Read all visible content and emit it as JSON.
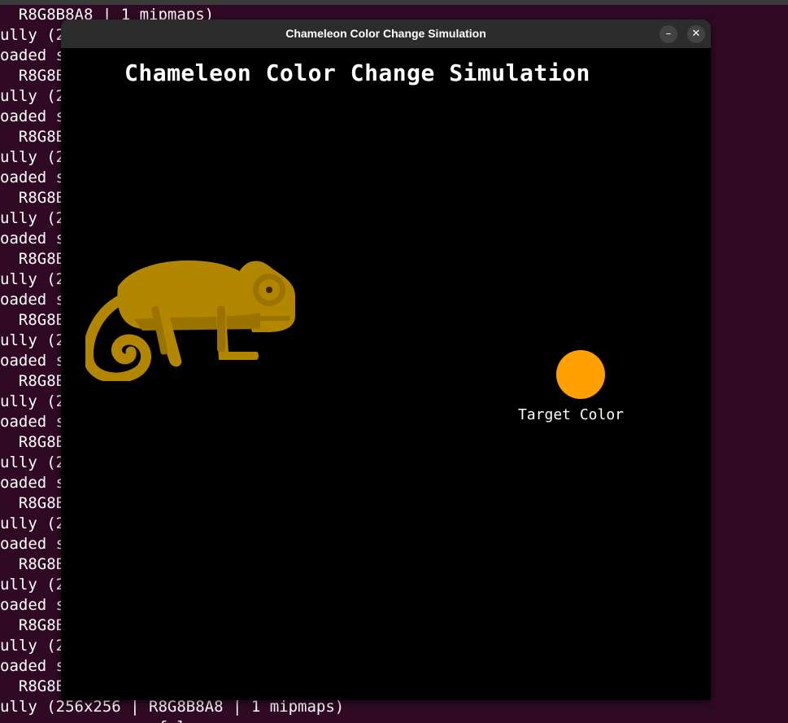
{
  "terminal": {
    "lines": [
      "  R8G8B8A8 | 1 mipmaps)",
      "ully (2",
      "oaded s",
      "  R8G8B8A",
      "ully (2",
      "oaded s",
      "  R8G8B8A",
      "ully (2",
      "oaded s",
      "  R8G8B8A",
      "ully (2",
      "oaded s",
      "  R8G8B8A",
      "ully (2",
      "oaded s",
      "  R8G8B8A",
      "ully (2",
      "oaded s",
      "  R8G8B8A",
      "ully (2",
      "oaded s",
      "  R8G8B8A",
      "ully (2",
      "oaded s",
      "  R8G8B8A",
      "ully (2",
      "oaded s",
      "  R8G8B8A",
      "ully (2",
      "oaded s",
      "  R8G8B8A",
      "ully (2",
      "oaded s",
      "  R8G8B8A",
      "ully (256x256 | R8G8B8A8 | 1 mipmaps)",
      "          s      ful"
    ]
  },
  "window": {
    "title": "Chameleon Color Change Simulation",
    "minimize_glyph": "–",
    "close_glyph": "✕"
  },
  "simulation": {
    "title": "Chameleon Color Change Simulation",
    "target_label": "Target Color",
    "target_color": "#ffa000",
    "chameleon_color": "#b38600",
    "chameleon_shade": "#9a7300"
  }
}
